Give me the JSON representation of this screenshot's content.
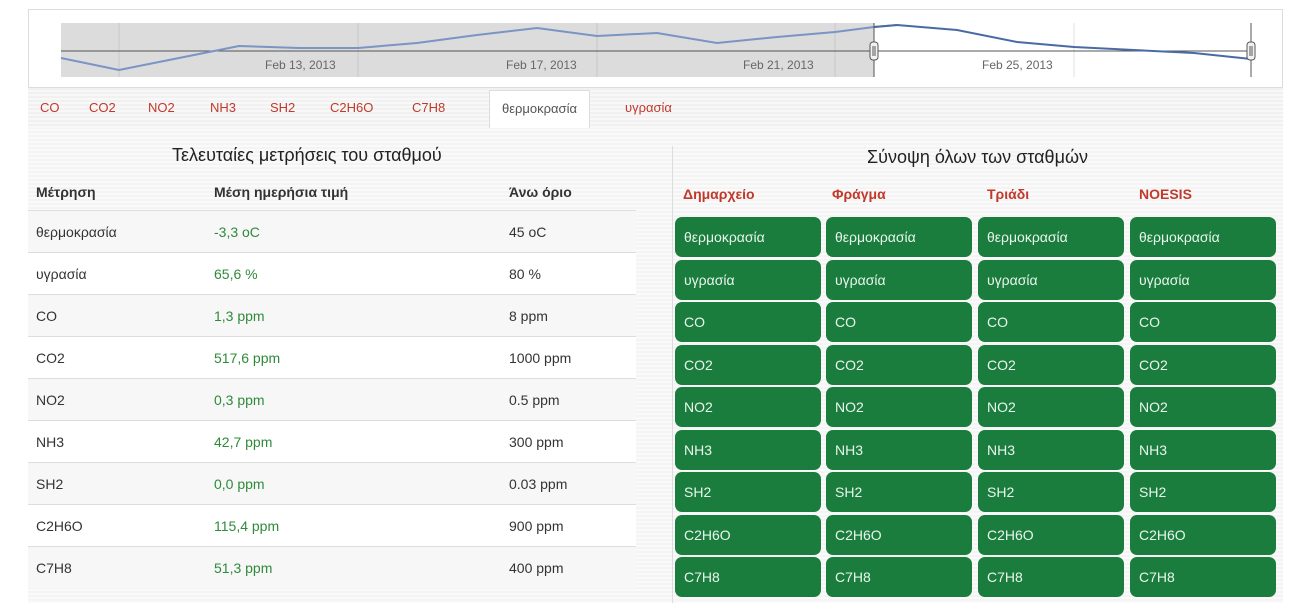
{
  "navigator": {
    "dates": [
      "Feb 13, 2013",
      "Feb 17, 2013",
      "Feb 21, 2013",
      "Feb 25, 2013"
    ]
  },
  "tabs": [
    {
      "label": "CO",
      "active": false
    },
    {
      "label": "CO2",
      "active": false
    },
    {
      "label": "NO2",
      "active": false
    },
    {
      "label": "NH3",
      "active": false
    },
    {
      "label": "SH2",
      "active": false
    },
    {
      "label": "C2H6O",
      "active": false
    },
    {
      "label": "C7H8",
      "active": false
    },
    {
      "label": "θερμοκρασία",
      "active": true
    },
    {
      "label": "υγρασία",
      "active": false
    }
  ],
  "left": {
    "title": "Τελευταίες μετρήσεις του σταθμού",
    "headers": [
      "Μέτρηση",
      "Μέση ημερήσια τιμή",
      "Άνω όριο"
    ],
    "rows": [
      {
        "name": "θερμοκρασία",
        "value": "-3,3 oC",
        "limit": "45 oC"
      },
      {
        "name": "υγρασία",
        "value": "65,6 %",
        "limit": "80 %"
      },
      {
        "name": "CO",
        "value": "1,3 ppm",
        "limit": "8 ppm"
      },
      {
        "name": "CO2",
        "value": "517,6 ppm",
        "limit": "1000 ppm"
      },
      {
        "name": "NO2",
        "value": "0,3 ppm",
        "limit": "0.5 ppm"
      },
      {
        "name": "NH3",
        "value": "42,7 ppm",
        "limit": "300 ppm"
      },
      {
        "name": "SH2",
        "value": "0,0 ppm",
        "limit": "0.03 ppm"
      },
      {
        "name": "C2H6O",
        "value": "115,4 ppm",
        "limit": "900 ppm"
      },
      {
        "name": "C7H8",
        "value": "51,3 ppm",
        "limit": "400 ppm"
      }
    ]
  },
  "right": {
    "title": "Σύνοψη όλων των σταθμών",
    "stations": [
      "Δημαρχείο",
      "Φράγμα",
      "Τριάδι",
      "NOESIS"
    ],
    "measures": [
      "θερμοκρασία",
      "υγρασία",
      "CO",
      "CO2",
      "NO2",
      "NH3",
      "SH2",
      "C2H6O",
      "C7H8"
    ]
  },
  "colors": {
    "accent_red": "#c0392b",
    "ok_green": "#1a7d3e",
    "value_green": "#2e8b3a"
  }
}
